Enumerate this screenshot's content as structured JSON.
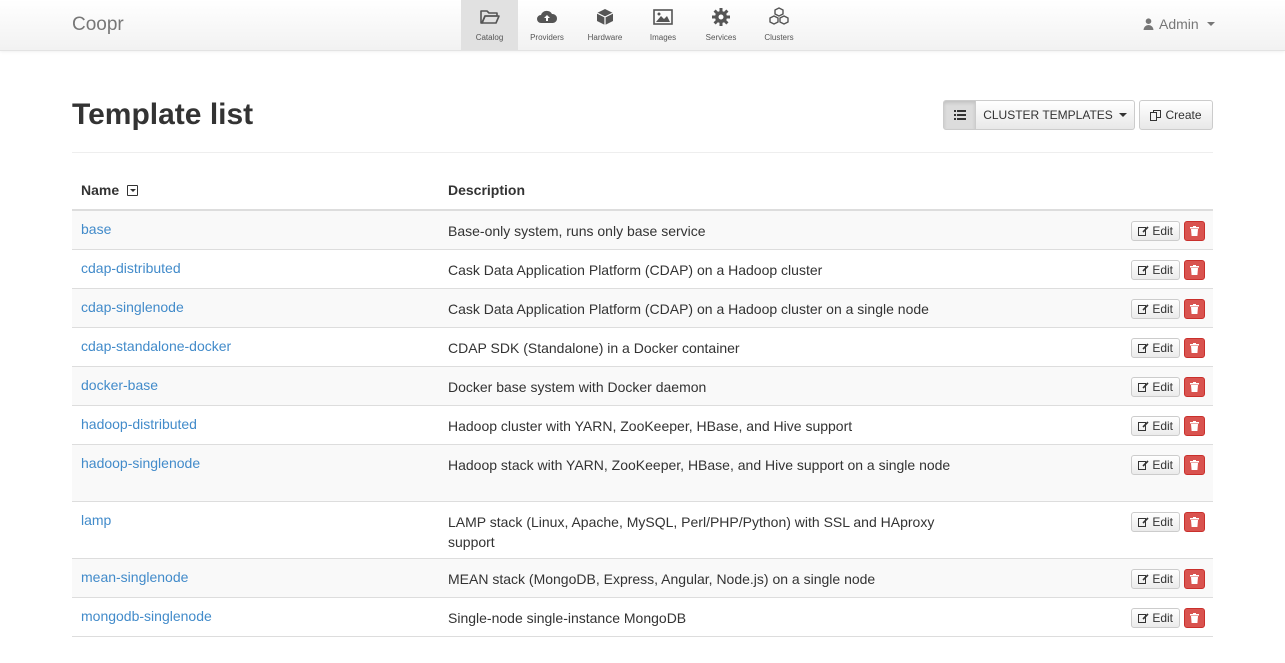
{
  "brand": "Coopr",
  "nav": [
    {
      "label": "Catalog",
      "icon": "folder-open-icon",
      "active": true
    },
    {
      "label": "Providers",
      "icon": "cloud-upload-icon",
      "active": false
    },
    {
      "label": "Hardware",
      "icon": "cube-icon",
      "active": false
    },
    {
      "label": "Images",
      "icon": "picture-icon",
      "active": false
    },
    {
      "label": "Services",
      "icon": "gear-icon",
      "active": false
    },
    {
      "label": "Clusters",
      "icon": "cubes-icon",
      "active": false
    }
  ],
  "user": {
    "name": "Admin",
    "icon": "user-icon"
  },
  "page": {
    "title": "Template list",
    "view_selector": "CLUSTER TEMPLATES",
    "create_label": "Create"
  },
  "table": {
    "headers": {
      "name": "Name",
      "description": "Description"
    },
    "edit_label": "Edit",
    "rows": [
      {
        "name": "base",
        "description": "Base-only system, runs only base service"
      },
      {
        "name": "cdap-distributed",
        "description": "Cask Data Application Platform (CDAP) on a Hadoop cluster"
      },
      {
        "name": "cdap-singlenode",
        "description": "Cask Data Application Platform (CDAP) on a Hadoop cluster on a single node"
      },
      {
        "name": "cdap-standalone-docker",
        "description": "CDAP SDK (Standalone) in a Docker container"
      },
      {
        "name": "docker-base",
        "description": "Docker base system with Docker daemon"
      },
      {
        "name": "hadoop-distributed",
        "description": "Hadoop cluster with YARN, ZooKeeper, HBase, and Hive support"
      },
      {
        "name": "hadoop-singlenode",
        "description": "Hadoop stack with YARN, ZooKeeper, HBase, and Hive support on a single node"
      },
      {
        "name": "lamp",
        "description": "LAMP stack (Linux, Apache, MySQL, Perl/PHP/Python) with SSL and HAproxy support"
      },
      {
        "name": "mean-singlenode",
        "description": "MEAN stack (MongoDB, Express, Angular, Node.js) on a single node"
      },
      {
        "name": "mongodb-singlenode",
        "description": "Single-node single-instance MongoDB"
      }
    ]
  },
  "colors": {
    "link": "#428bca",
    "danger": "#d9534f"
  }
}
